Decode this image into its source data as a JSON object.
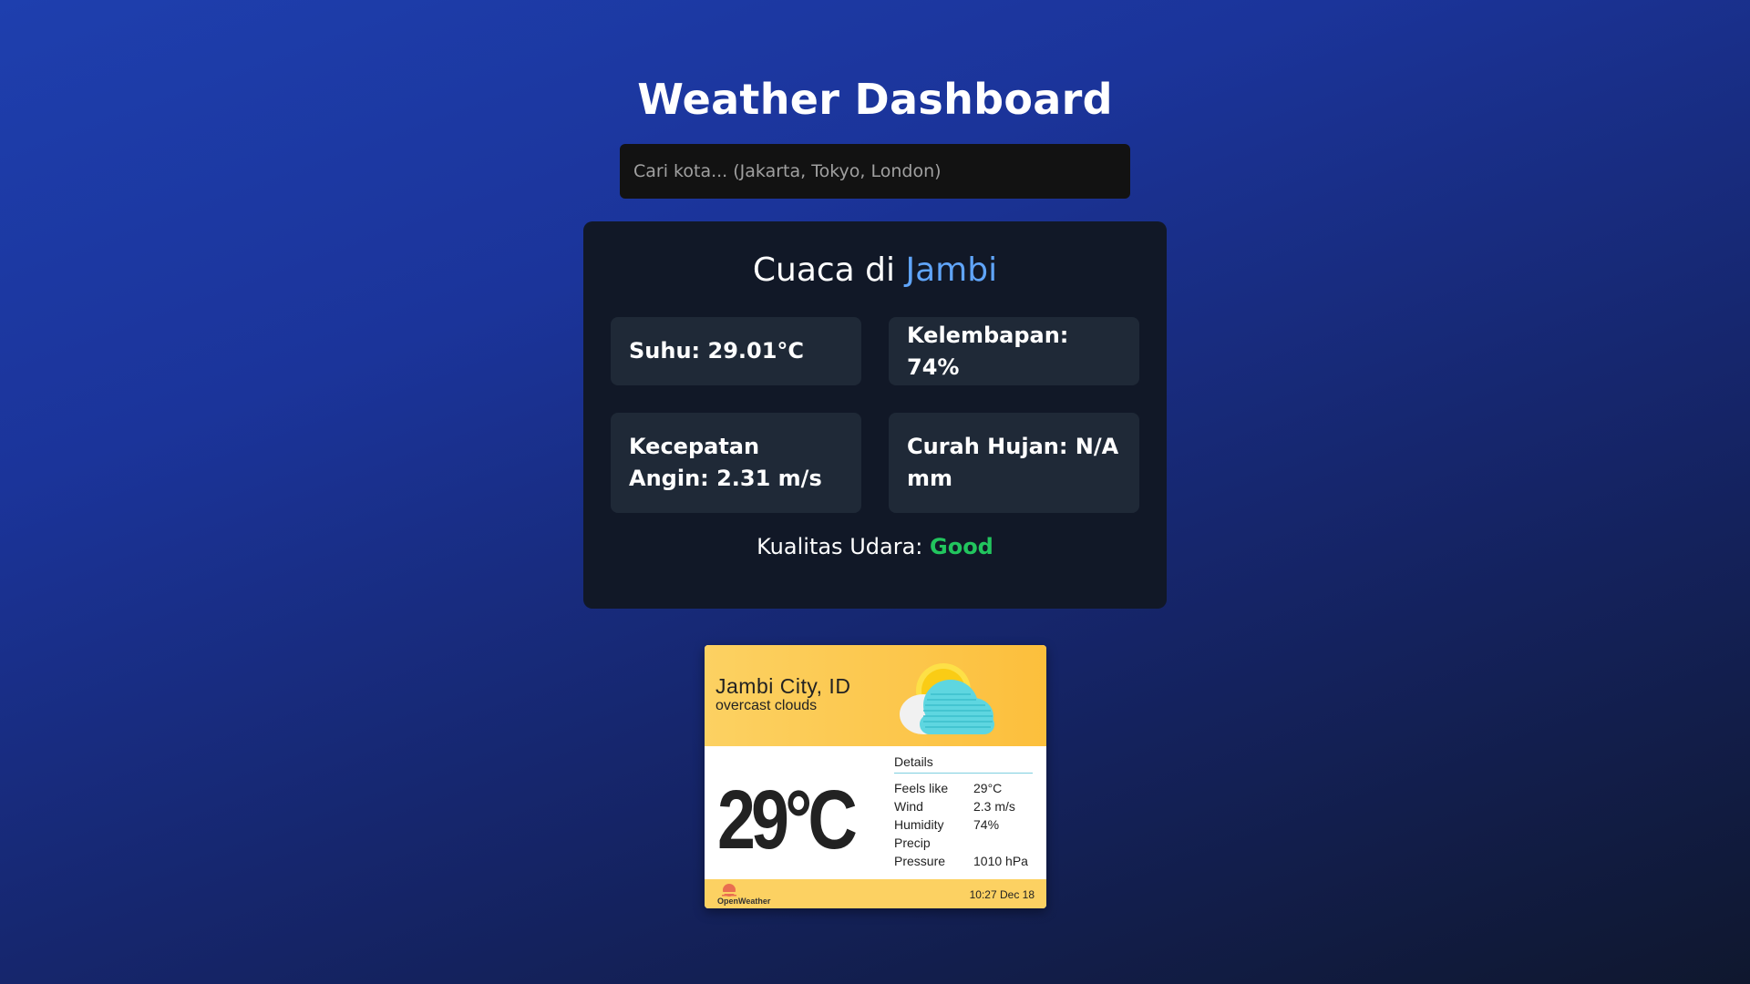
{
  "header": {
    "title": "Weather Dashboard"
  },
  "search": {
    "placeholder": "Cari kota... (Jakarta, Tokyo, London)",
    "value": ""
  },
  "weather_card": {
    "heading_prefix": "Cuaca di",
    "city": "Jambi",
    "city_color": "#60a5fa",
    "temperature": "Suhu: 29.01°C",
    "humidity": "Kelembapan: 74%",
    "wind": "Kecepatan Angin: 2.31 m/s",
    "rain": "Curah Hujan: N/A mm",
    "air_quality_label": "Kualitas Udara:",
    "air_quality_value": "Good",
    "air_quality_color": "#22c55e"
  },
  "openweather_widget": {
    "city": "Jambi City, ID",
    "description": "overcast clouds",
    "icon": "sun-behind-cloud-icon",
    "temperature": "29°C",
    "details_title": "Details",
    "details": [
      {
        "label": "Feels like",
        "value": "29°C"
      },
      {
        "label": "Wind",
        "value": "2.3 m/s"
      },
      {
        "label": "Humidity",
        "value": "74%"
      },
      {
        "label": "Precip",
        "value": ""
      },
      {
        "label": "Pressure",
        "value": "1010 hPa"
      }
    ],
    "brand": "OpenWeather",
    "timestamp": "10:27 Dec 18"
  },
  "colors": {
    "background_start": "#1e3fae",
    "background_end": "#0f172e",
    "card_bg": "#111827",
    "stat_bg": "#1f2937",
    "widget_top": "#fcd162"
  }
}
